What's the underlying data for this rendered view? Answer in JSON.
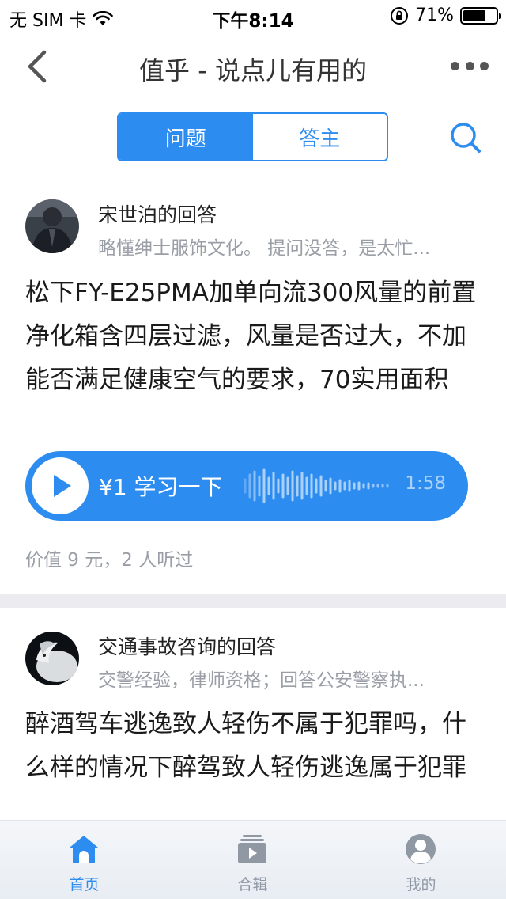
{
  "status_bar": {
    "carrier": "无 SIM 卡",
    "time": "下午8:14",
    "battery": "71%",
    "battery_level": 0.71
  },
  "nav": {
    "title": "值乎 - 说点儿有用的"
  },
  "tabs": {
    "items": [
      {
        "label": "问题",
        "active": true
      },
      {
        "label": "答主",
        "active": false
      }
    ]
  },
  "feed": [
    {
      "answerer": "宋世泊的回答",
      "bio": "略懂绅士服饰文化。 提问没答，是太忙...",
      "question": "松下FY-E25PMA加单向流300风量的前置净化箱含四层过滤，风量是否过大，不加能否满足健康空气的要求，70实用面积",
      "audio": {
        "price_label": "¥1 学习一下",
        "duration": "1:58"
      },
      "stats": "价值 9 元，2 人听过"
    },
    {
      "answerer": "交通事故咨询的回答",
      "bio": "交警经验，律师资格；回答公安警察执...",
      "question": "醉酒驾车逃逸致人轻伤不属于犯罪吗，什么样的情况下醉驾致人轻伤逃逸属于犯罪"
    }
  ],
  "bottom_nav": {
    "items": [
      {
        "label": "首页",
        "active": true
      },
      {
        "label": "合辑",
        "active": false
      },
      {
        "label": "我的",
        "active": false
      }
    ]
  },
  "colors": {
    "accent": "#2d8cf0",
    "secondary_text": "#9a9ea6",
    "divider": "#ececf0"
  }
}
